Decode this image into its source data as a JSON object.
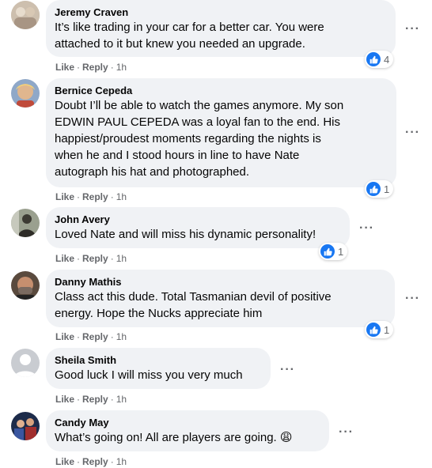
{
  "labels": {
    "like": "Like",
    "reply": "Reply",
    "more": "···",
    "dot": "·"
  },
  "colors": {
    "bubble": "#f0f2f5",
    "like_blue": "#1877f2",
    "meta_gray": "#65676b"
  },
  "comments": [
    {
      "author": "Jeremy Craven",
      "text": "It’s like trading in your car for a better car. You were\nattached to it but knew you needed an upgrade.",
      "time": "1h",
      "reaction_icon": "like-icon",
      "reaction_count": "4"
    },
    {
      "author": "Bernice Cepeda",
      "text": "Doubt I’ll be able to watch the games anymore. My son\nEDWIN PAUL CEPEDA was a loyal fan to the end. His\nhappiest/proudest moments regarding the nights is\nwhen he and I stood hours in line to have Nate\nautograph his hat and photographed.",
      "time": "1h",
      "reaction_icon": "like-icon",
      "reaction_count": "1"
    },
    {
      "author": "John Avery",
      "text": "Loved Nate and will miss his dynamic personality!",
      "time": "1h",
      "reaction_icon": "like-icon",
      "reaction_count": "1"
    },
    {
      "author": "Danny Mathis",
      "text": "Class act this dude. Total Tasmanian devil of positive\nenergy. Hope the Nucks appreciate him",
      "time": "1h",
      "reaction_icon": "like-icon",
      "reaction_count": "1"
    },
    {
      "author": "Sheila Smith",
      "text": "Good luck I will miss you very much",
      "time": "1h"
    },
    {
      "author": "Candy May",
      "text": "What’s going on! All are players are going.",
      "emoji": "😩",
      "time": "1h"
    }
  ]
}
